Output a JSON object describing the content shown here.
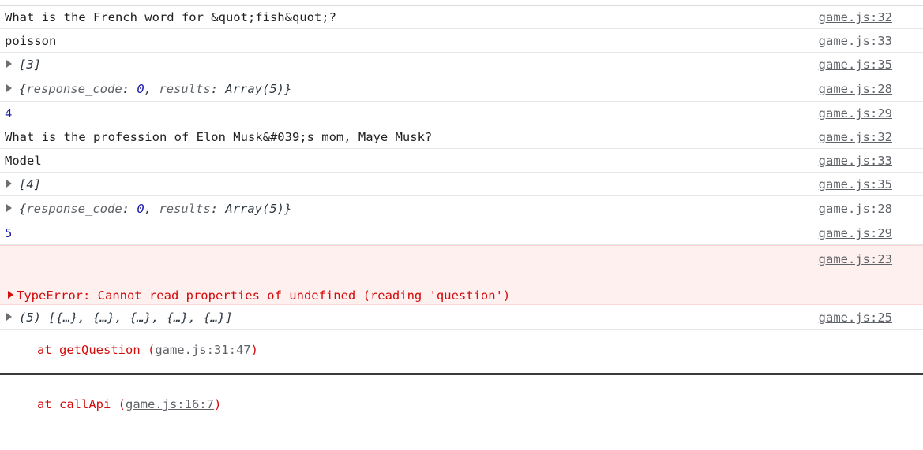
{
  "rows": [
    {
      "text": "What is the French word for &quot;fish&quot;?",
      "src": "game.js:32"
    },
    {
      "text": "poisson",
      "src": "game.js:33"
    },
    {
      "text": "[3]",
      "src": "game.js:35"
    },
    {
      "key1": "response_code",
      "val1": "0",
      "key2": "results",
      "val2": "Array(5)",
      "src": "game.js:28"
    },
    {
      "text": "4",
      "src": "game.js:29"
    },
    {
      "text": "What is the profession of Elon Musk&#039;s mom, Maye Musk?",
      "src": "game.js:32"
    },
    {
      "text": "Model",
      "src": "game.js:33"
    },
    {
      "text": "[4]",
      "src": "game.js:35"
    },
    {
      "key1": "response_code",
      "val1": "0",
      "key2": "results",
      "val2": "Array(5)",
      "src": "game.js:28"
    },
    {
      "text": "5",
      "src": "game.js:29"
    }
  ],
  "error": {
    "message": "TypeError: Cannot read properties of undefined (reading 'question')",
    "frame1_fn": "at getQuestion (",
    "frame1_link": "game.js:31:47",
    "frame2_fn": "at callApi (",
    "frame2_link": "game.js:16:7",
    "close": ")",
    "src": "game.js:23"
  },
  "last": {
    "text": "(5) [{…}, {…}, {…}, {…}, {…}]",
    "src": "game.js:25"
  }
}
